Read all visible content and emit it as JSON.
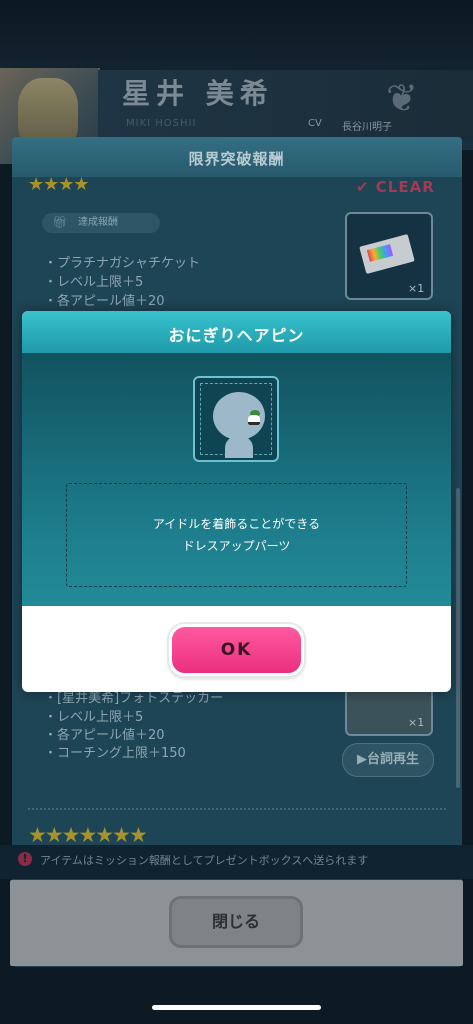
{
  "profile": {
    "idol_name": "星井 美希",
    "romaji": "MIKI HOSHII",
    "cv_label": "CV",
    "cv_name": "長谷川明子"
  },
  "panel": {
    "title": "限界突破報酬",
    "stars_top": "★★★★",
    "clear_label": "✔ CLEAR",
    "reward_badge": "達成報酬",
    "rewards_1": [
      "・プラチナガシャチケット",
      "・レベル上限＋5",
      "・各アピール値＋20"
    ],
    "card1_count": "×1",
    "rewards_2": [
      "・[星井美希]フォトステッカー",
      "・レベル上限＋5",
      "・各アピール値＋20",
      "・コーチング上限＋150"
    ],
    "card2_count": "×1",
    "replay_label": "▶台詞再生",
    "stars_bottom": "★★★★★★★"
  },
  "notice": {
    "text": "アイテムはミッション報酬としてプレゼントボックスへ送られます"
  },
  "footer": {
    "close_label": "閉じる"
  },
  "modal": {
    "title": "おにぎりヘアピン",
    "description_line1": "アイドルを着飾ることができる",
    "description_line2": "ドレスアップパーツ",
    "ok_label": "OK"
  },
  "colors": {
    "modal_header": "#2bb3c0",
    "ok_button": "#f23f8a",
    "clear": "#a03a55",
    "star": "#a8922b"
  },
  "icons": [
    "gift-icon",
    "warning-icon",
    "play-icon",
    "check-icon"
  ]
}
